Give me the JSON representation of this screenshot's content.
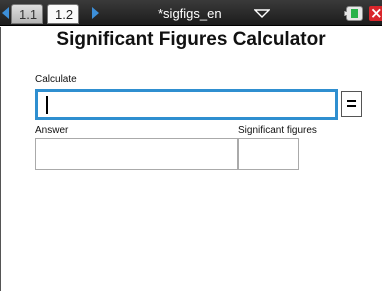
{
  "tabs": [
    {
      "label": "1.1"
    },
    {
      "label": "1.2"
    }
  ],
  "document": {
    "title": "*sigfigs_en"
  },
  "icons": {
    "nav_left": "chevron-left-icon",
    "nav_right": "chevron-right-icon",
    "doc_menu": "chevron-down-icon",
    "battery": "battery-icon",
    "close": "close-icon"
  },
  "colors": {
    "accent": "#2f8fd0",
    "nav_arrow": "#3d8fd8",
    "close": "#d9262b",
    "battery": "#29b24a"
  },
  "calculator": {
    "title": "Significant Figures Calculator",
    "calculate_label": "Calculate",
    "calculate_value": "",
    "equals_label": "=",
    "answer_label": "Answer",
    "answer_value": "",
    "sigfigs_label": "Significant figures",
    "sigfigs_value": ""
  }
}
